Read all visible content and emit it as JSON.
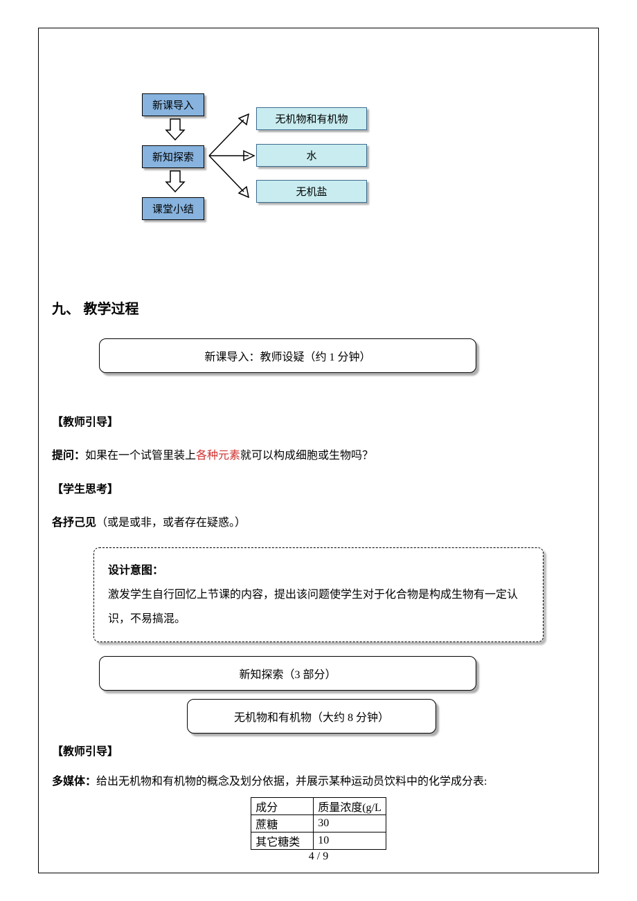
{
  "diagram": {
    "box1": "新课导入",
    "box2": "新知探索",
    "box3": "课堂小结",
    "out1": "无机物和有机物",
    "out2": "水",
    "out3": "无机盐"
  },
  "section_title": "九、  教学过程",
  "lead_box": "新课导入：教师设疑（约 1 分钟）",
  "teacher_guide_label": "【教师引导】",
  "question_label": "提问：",
  "question_pre": "如果在一个试管里装上",
  "question_red": "各种元素",
  "question_post": "就可以构成细胞或生物吗？",
  "student_think_label": "【学生思考】",
  "opinion_label": "各抒己见",
  "opinion_text": "（或是或非，或者存在疑惑。）",
  "intent_title": "设计意图：",
  "intent_body": "激发学生自行回忆上节课的内容，提出该问题使学生对于化合物是构成生物有一定认识，不易搞混。",
  "explore_box": "新知探索（3 部分）",
  "inorganic_box": "无机物和有机物（大约 8 分钟）",
  "teacher_guide_label2": "【教师引导】",
  "multimedia_label": "多媒体：",
  "multimedia_text": "给出无机物和有机物的概念及划分依据，并展示某种运动员饮料中的化学成分表:",
  "table": {
    "headers": [
      "成分",
      "质量浓度(g/L"
    ],
    "rows": [
      [
        "蔗糖",
        "30"
      ],
      [
        "其它糖类",
        "10"
      ]
    ]
  },
  "page_number": "4 / 9"
}
